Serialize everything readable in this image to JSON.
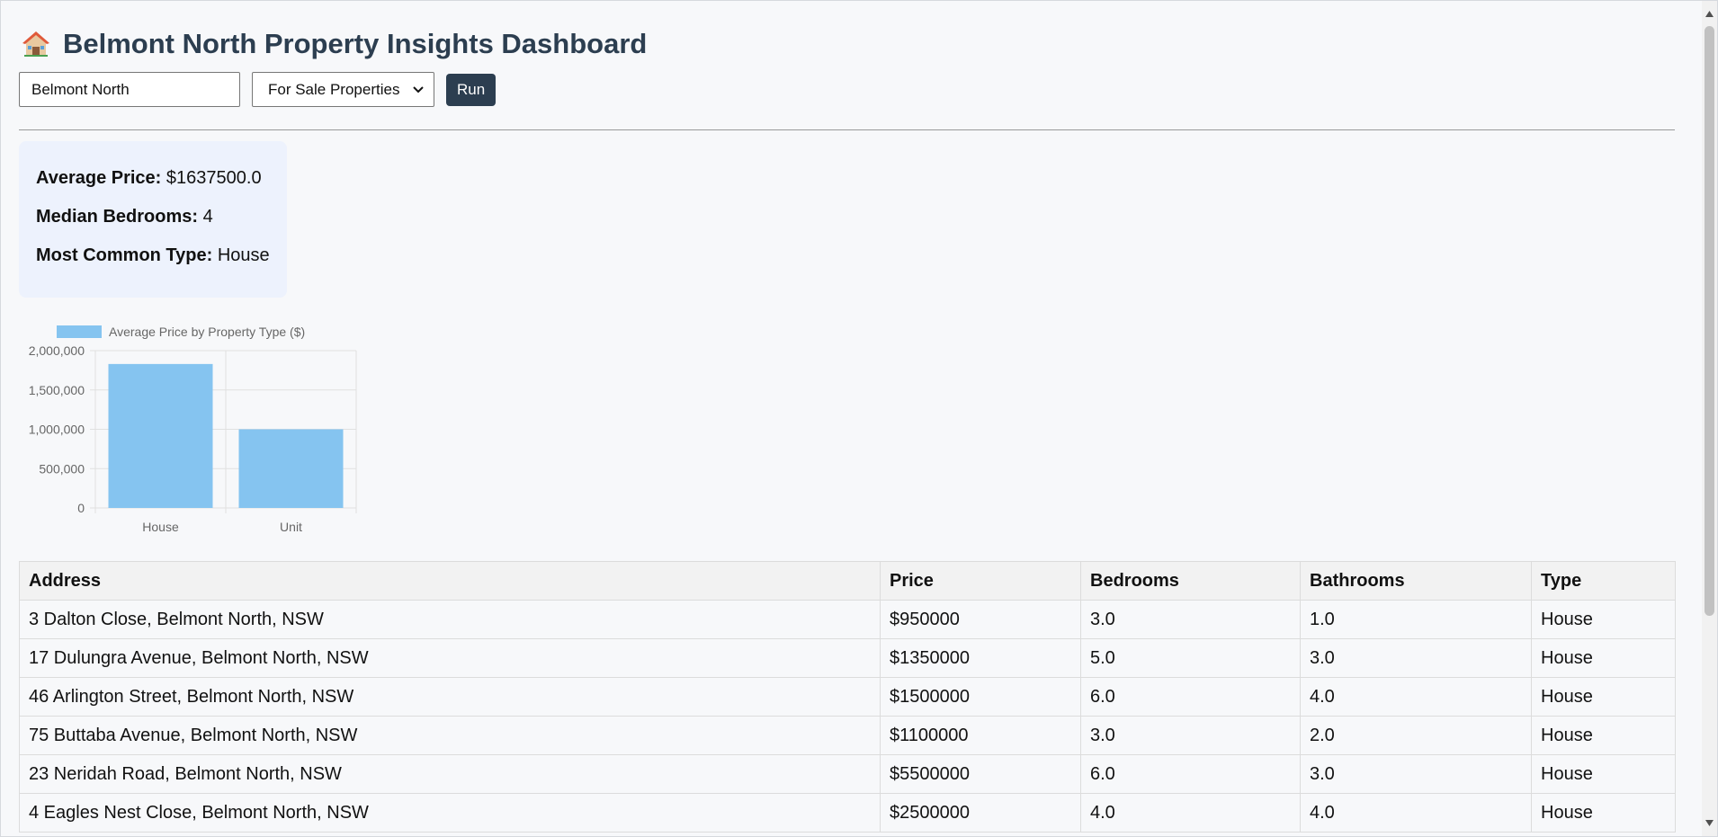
{
  "header": {
    "title": "Belmont North Property Insights Dashboard",
    "icon": "house-icon"
  },
  "controls": {
    "search_value": "Belmont North",
    "listing_type": "For Sale Properties",
    "listing_options": [
      "For Sale Properties"
    ],
    "run_label": "Run"
  },
  "summary": {
    "avg_price_label": "Average Price:",
    "avg_price_value": "$1637500.0",
    "median_bedrooms_label": "Median Bedrooms:",
    "median_bedrooms_value": "4",
    "common_type_label": "Most Common Type:",
    "common_type_value": "House"
  },
  "chart_data": {
    "type": "bar",
    "categories": [
      "House",
      "Unit"
    ],
    "series": [
      {
        "name": "Average Price by Property Type ($)",
        "values": [
          1830000,
          1000000
        ]
      }
    ],
    "ylim": [
      0,
      2000000
    ],
    "yticks": [
      0,
      500000,
      1000000,
      1500000,
      2000000
    ],
    "ytick_labels": [
      "0",
      "500,000",
      "1,000,000",
      "1,500,000",
      "2,000,000"
    ],
    "color": "#85c4f0",
    "grid": true,
    "legend": "top"
  },
  "table": {
    "columns": [
      "Address",
      "Price",
      "Bedrooms",
      "Bathrooms",
      "Type"
    ],
    "rows": [
      [
        "3 Dalton Close, Belmont North, NSW",
        "$950000",
        "3.0",
        "1.0",
        "House"
      ],
      [
        "17 Dulungra Avenue, Belmont North, NSW",
        "$1350000",
        "5.0",
        "3.0",
        "House"
      ],
      [
        "46 Arlington Street, Belmont North, NSW",
        "$1500000",
        "6.0",
        "4.0",
        "House"
      ],
      [
        "75 Buttaba Avenue, Belmont North, NSW",
        "$1100000",
        "3.0",
        "2.0",
        "House"
      ],
      [
        "23 Neridah Road, Belmont North, NSW",
        "$5500000",
        "6.0",
        "3.0",
        "House"
      ],
      [
        "4 Eagles Nest Close, Belmont North, NSW",
        "$2500000",
        "4.0",
        "4.0",
        "House"
      ]
    ]
  }
}
